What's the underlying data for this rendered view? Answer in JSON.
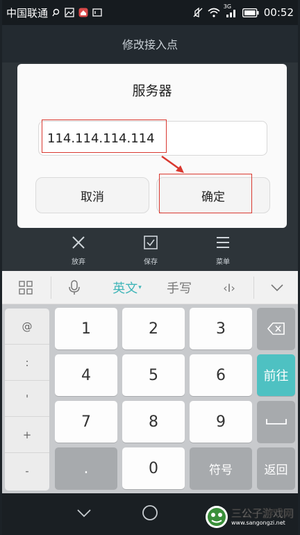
{
  "status_bar": {
    "carrier": "中国联通",
    "network": "3G",
    "time": "00:52"
  },
  "title_bar": {
    "title": "修改接入点"
  },
  "dialog": {
    "title": "服务器",
    "input_value": "114.114.114.114",
    "cancel_label": "取消",
    "ok_label": "确定"
  },
  "action_bar": {
    "items": [
      {
        "label": "放弃",
        "icon": "close-icon"
      },
      {
        "label": "保存",
        "icon": "save-icon"
      },
      {
        "label": "菜单",
        "icon": "menu-icon"
      }
    ]
  },
  "ime_toolbar": {
    "mode_label": "英文",
    "handwrite_label": "手写",
    "cursor_label": "‹I›"
  },
  "keyboard": {
    "symbols": [
      "@",
      ":",
      "'",
      "+",
      "-"
    ],
    "keys": [
      "1",
      "2",
      "3",
      "4",
      "5",
      "6",
      "7",
      "8",
      "9",
      ".",
      "0"
    ],
    "symbols_key": "符号",
    "next_key": "前往",
    "back_key": "返回"
  },
  "watermark": {
    "title": "三公子游戏网",
    "url": "www.sangongzi.net"
  },
  "colors": {
    "accent_teal": "#4ec1c2",
    "highlight_red": "#d9382f"
  }
}
